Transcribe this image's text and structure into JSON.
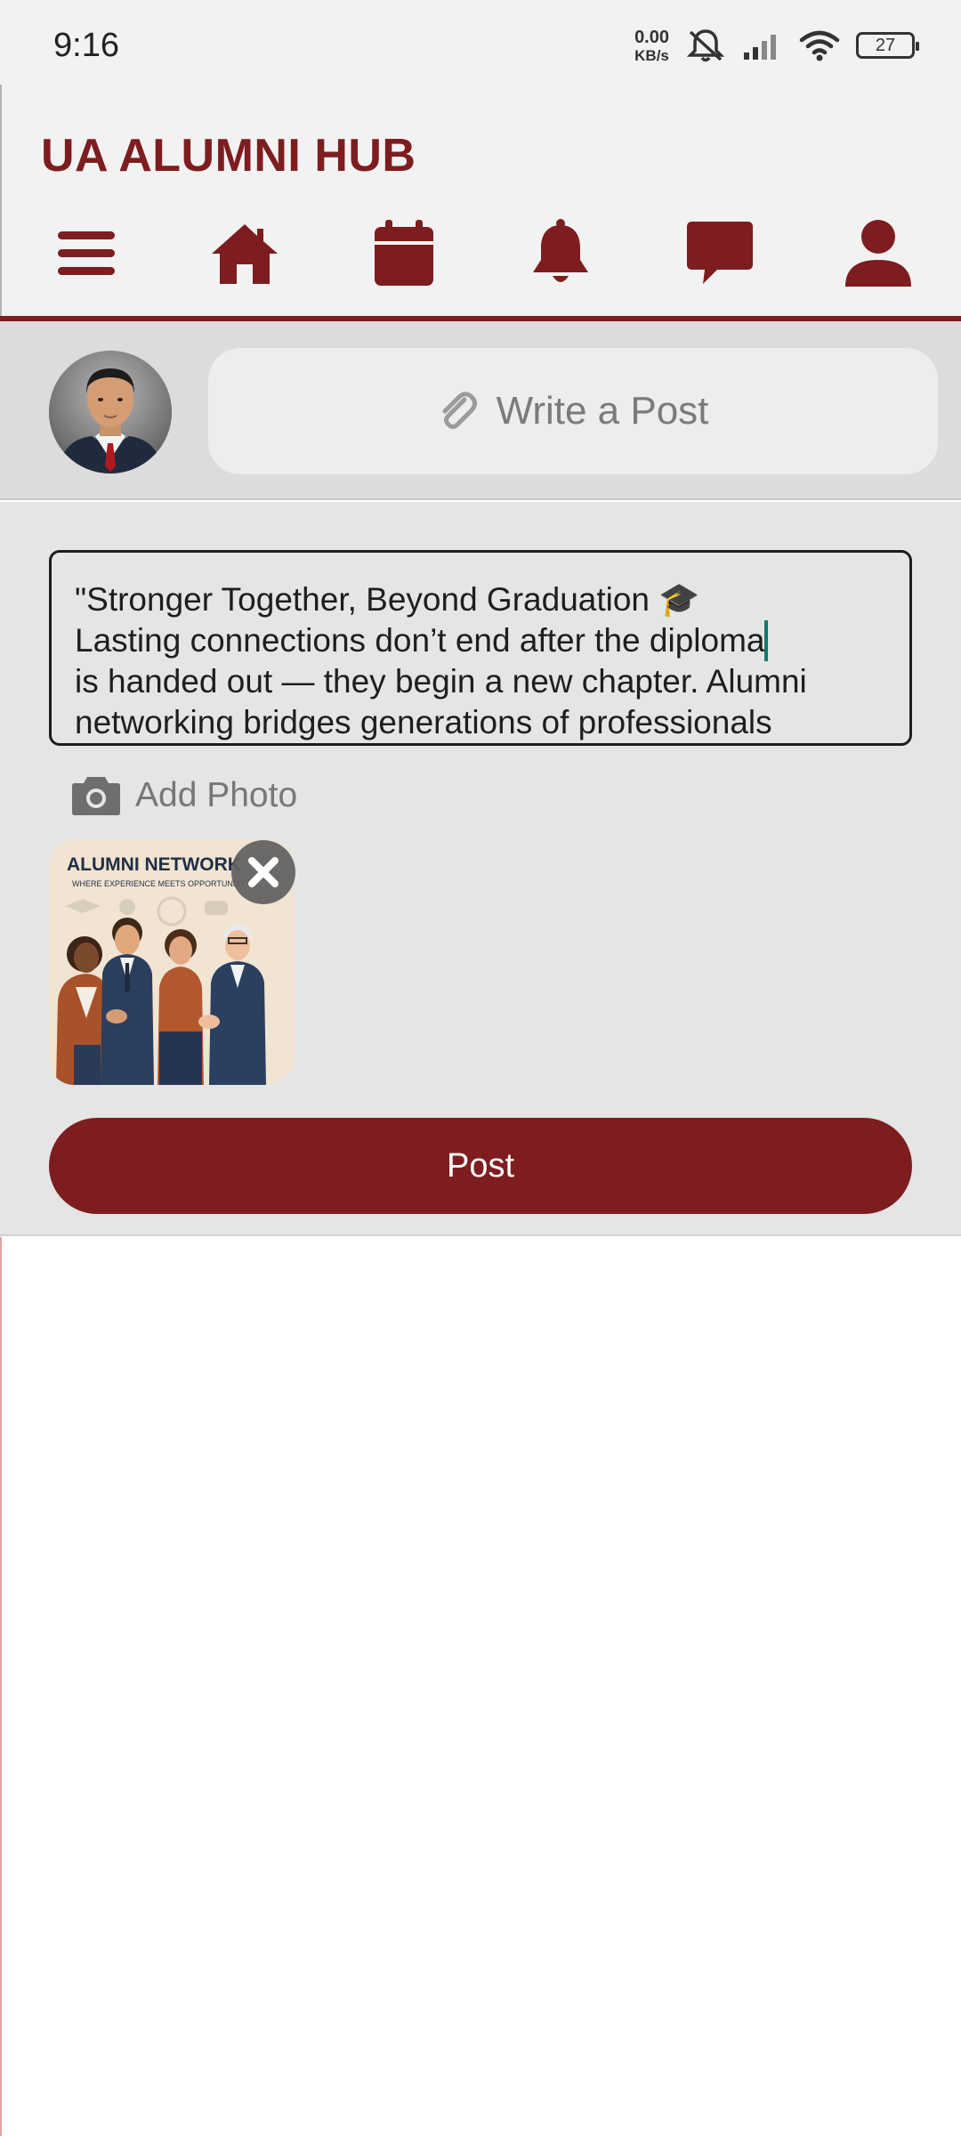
{
  "status_bar": {
    "time": "9:16",
    "net_speed_value": "0.00",
    "net_speed_unit": "KB/s",
    "battery": "27",
    "icons": [
      "mute-icon",
      "signal-icon",
      "wifi-icon",
      "battery-icon"
    ]
  },
  "header": {
    "title": "UA ALUMNI HUB",
    "nav": [
      {
        "name": "menu-icon"
      },
      {
        "name": "home-icon"
      },
      {
        "name": "calendar-icon"
      },
      {
        "name": "bell-icon"
      },
      {
        "name": "chat-icon"
      },
      {
        "name": "profile-icon"
      }
    ]
  },
  "composer": {
    "write_label": "Write a Post",
    "icon": "paperclip-icon"
  },
  "post_form": {
    "text_lines": [
      "\"Stronger Together, Beyond Graduation 🎓",
      "Lasting connections don’t end after the diploma",
      "is handed out — they begin a new chapter. Alumni",
      "networking bridges generations of professionals"
    ],
    "add_photo_label": "Add Photo",
    "photo_title": "ALUMNI NETWORK",
    "photo_subtitle": "WHERE EXPERIENCE MEETS OPPORTUNITY",
    "post_label": "Post"
  },
  "colors": {
    "brand": "#7d1d1f",
    "caret": "#127a67"
  }
}
